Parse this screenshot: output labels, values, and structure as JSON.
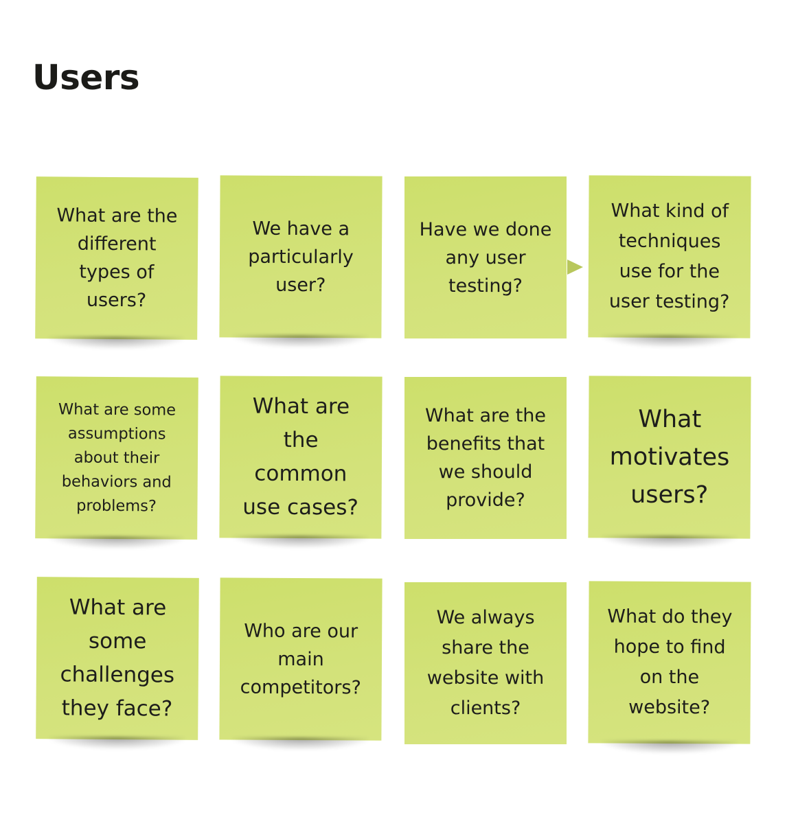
{
  "board": {
    "title": "Users",
    "note_color": "#d0e072",
    "connector_color": "#b8c75c"
  },
  "notes": [
    {
      "text": "What are the different types of users?"
    },
    {
      "text": "We have a particularly user?"
    },
    {
      "text": "Have we done any user testing?"
    },
    {
      "text": "What kind of techniques use for the user testing?"
    },
    {
      "text": "What are some assumptions about their behaviors and problems?"
    },
    {
      "text": "What are the common use cases?"
    },
    {
      "text": "What are the benefits that we should provide?"
    },
    {
      "text": "What motivates users?"
    },
    {
      "text": "What are some challenges they face?"
    },
    {
      "text": "Who are our main competitors?"
    },
    {
      "text": "We always share the website with clients?"
    },
    {
      "text": "What do they hope to find on the website?"
    }
  ],
  "connectors": [
    {
      "from": "Have we done any user testing?",
      "to": "What kind of techniques use for the user testing?",
      "icon": "arrow-right-icon"
    }
  ]
}
